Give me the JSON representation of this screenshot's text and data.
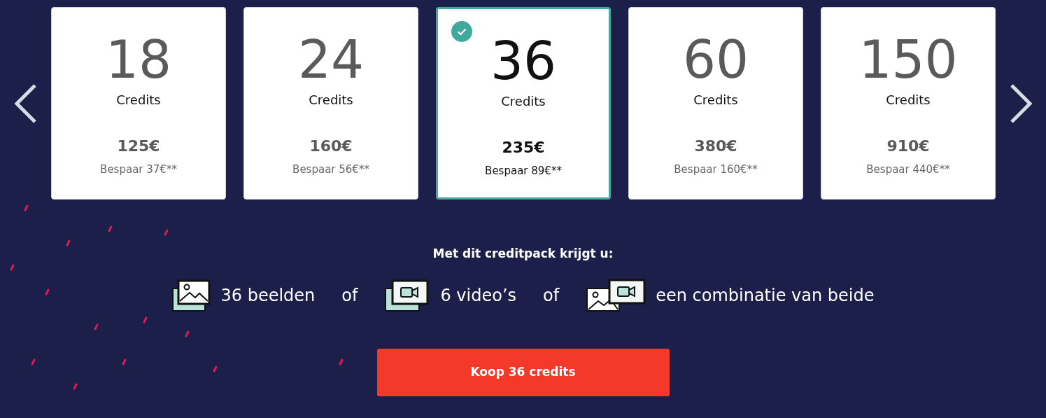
{
  "packs": [
    {
      "amount": "18",
      "unit": "Credits",
      "price": "125€",
      "saving": "Bespaar 37€**",
      "selected": false
    },
    {
      "amount": "24",
      "unit": "Credits",
      "price": "160€",
      "saving": "Bespaar 56€**",
      "selected": false
    },
    {
      "amount": "36",
      "unit": "Credits",
      "price": "235€",
      "saving": "Bespaar 89€**",
      "selected": true
    },
    {
      "amount": "60",
      "unit": "Credits",
      "price": "380€",
      "saving": "Bespaar 160€**",
      "selected": false
    },
    {
      "amount": "150",
      "unit": "Credits",
      "price": "910€",
      "saving": "Bespaar 440€**",
      "selected": false
    }
  ],
  "heading": "Met dit creditpack krijgt u:",
  "benefits": [
    {
      "kind": "image",
      "text": "36 beelden"
    },
    {
      "kind": "separator",
      "text": "of"
    },
    {
      "kind": "video",
      "text": "6 video’s"
    },
    {
      "kind": "separator",
      "text": "of"
    },
    {
      "kind": "combo",
      "text": "een combinatie van beide"
    }
  ],
  "buy_button": "Koop 36 credits"
}
